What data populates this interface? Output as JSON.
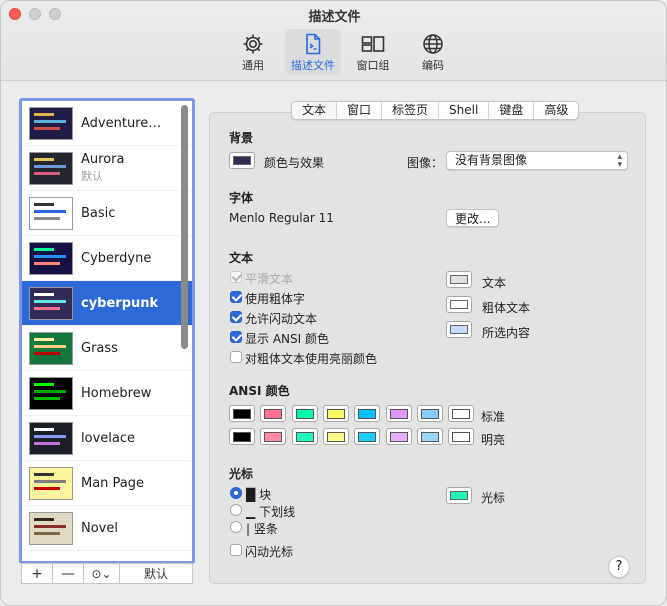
{
  "window": {
    "title": "描述文件"
  },
  "toolbar": [
    {
      "label": "通用",
      "icon": "gear-icon",
      "active": false
    },
    {
      "label": "描述文件",
      "icon": "document-icon",
      "active": true
    },
    {
      "label": "窗口组",
      "icon": "window-group-icon",
      "active": false
    },
    {
      "label": "编码",
      "icon": "globe-icon",
      "active": false
    }
  ],
  "profiles": [
    {
      "name": "AdventureTi...",
      "sub": "",
      "bg": "#1f1d45",
      "c1": "#e0b64a",
      "c2": "#5fb1d9",
      "c3": "#d04c4c",
      "selected": false
    },
    {
      "name": "Aurora",
      "sub": "默认",
      "bg": "#23262e",
      "c1": "#e6c75d",
      "c2": "#6f9ad7",
      "c3": "#d95d7f",
      "selected": false
    },
    {
      "name": "Basic",
      "sub": "",
      "bg": "#ffffff",
      "c1": "#333333",
      "c2": "#2a6ad8",
      "c3": "#888888",
      "selected": false
    },
    {
      "name": "Cyberdyne",
      "sub": "",
      "bg": "#151144",
      "c1": "#00fe9b",
      "c2": "#2a8eff",
      "c3": "#ff8373",
      "selected": false
    },
    {
      "name": "cyberpunk",
      "sub": "",
      "bg": "#332a57",
      "c1": "#ffffff",
      "c2": "#63e6e0",
      "c3": "#ff7092",
      "selected": true
    },
    {
      "name": "Grass",
      "sub": "",
      "bg": "#13773d",
      "c1": "#fff0a5",
      "c2": "#ffcf86",
      "c3": "#bb0000",
      "selected": false
    },
    {
      "name": "Homebrew",
      "sub": "",
      "bg": "#000000",
      "c1": "#00ff00",
      "c2": "#00a600",
      "c3": "#00c000",
      "selected": false
    },
    {
      "name": "lovelace",
      "sub": "",
      "bg": "#1d1f28",
      "c1": "#ffffff",
      "c2": "#8897f4",
      "c3": "#c574dd",
      "selected": false
    },
    {
      "name": "Man Page",
      "sub": "",
      "bg": "#fef49c",
      "c1": "#333333",
      "c2": "#7f7f7f",
      "c3": "#cc0000",
      "selected": false
    },
    {
      "name": "Novel",
      "sub": "",
      "bg": "#dfdbc3",
      "c1": "#3b2322",
      "c2": "#8b2c2b",
      "c3": "#7a6a45",
      "selected": false
    }
  ],
  "sidebar_buttons": {
    "add": "+",
    "remove": "—",
    "more": "⊙⌄",
    "default": "默认"
  },
  "tabs": [
    "文本",
    "窗口",
    "标签页",
    "Shell",
    "键盘",
    "高级"
  ],
  "background": {
    "title": "背景",
    "color_label": "颜色与效果",
    "color": "#332a57",
    "image_label": "图像：",
    "image_value": "没有背景图像"
  },
  "font": {
    "title": "字体",
    "value": "Menlo Regular 11",
    "change_button": "更改..."
  },
  "text": {
    "title": "文本",
    "options": [
      {
        "label": "平滑文本",
        "state": "disabled"
      },
      {
        "label": "使用粗体字",
        "state": "checked"
      },
      {
        "label": "允许闪动文本",
        "state": "checked"
      },
      {
        "label": "显示 ANSI 颜色",
        "state": "checked"
      },
      {
        "label": "对粗体文本使用亮丽颜色",
        "state": "unchecked"
      }
    ],
    "colors": [
      {
        "label": "文本",
        "color": "#e0e0e0"
      },
      {
        "label": "粗体文本",
        "color": "#ffffff"
      },
      {
        "label": "所选内容",
        "color": "#c6dbfa"
      }
    ]
  },
  "ansi": {
    "title": "ANSI 颜色",
    "normal_label": "标准",
    "bright_label": "明亮",
    "normal": [
      "#000000",
      "#ff7092",
      "#00fbac",
      "#fffa6a",
      "#00bfff",
      "#df95ff",
      "#86cbfe",
      "#ffffff"
    ],
    "bright": [
      "#000000",
      "#ff8aa4",
      "#21f6bc",
      "#fff787",
      "#1bccfd",
      "#e6aefe",
      "#99d6fc",
      "#ffffff"
    ]
  },
  "cursor": {
    "title": "光标",
    "options": [
      {
        "glyph": "█",
        "label": "块",
        "selected": true
      },
      {
        "glyph": "▁",
        "label": "下划线",
        "selected": false
      },
      {
        "glyph": "|",
        "label": "竖条",
        "selected": false
      }
    ],
    "blink_label": "闪动光标",
    "color_label": "光标",
    "color": "#21f6bc"
  },
  "help": "?"
}
